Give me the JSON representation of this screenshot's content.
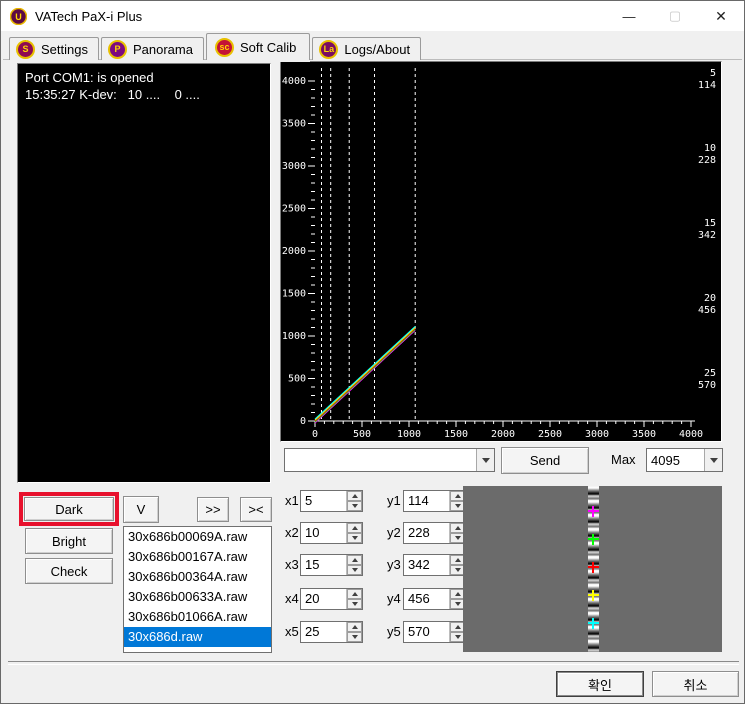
{
  "window": {
    "title": "VATech PaX-i Plus",
    "minimize_glyph": "—",
    "maximize_glyph": "▢",
    "close_glyph": "✕"
  },
  "tabs": [
    {
      "label": "Settings",
      "badge": "S",
      "badge_color": "#8e0b52",
      "active": false
    },
    {
      "label": "Panorama",
      "badge": "P",
      "badge_color": "#7c0a80",
      "active": false
    },
    {
      "label": "Soft Calib",
      "badge": "sc",
      "badge_color": "#c41236",
      "active": true
    },
    {
      "label": "Logs/About",
      "badge": "La",
      "badge_color": "#7a0d62",
      "active": false
    }
  ],
  "log": {
    "lines": [
      "Port COM1: is opened",
      "15:35:27 K-dev:   10 ....    0 ...."
    ]
  },
  "chart_data": {
    "type": "line",
    "title": "",
    "xlabel": "",
    "ylabel": "",
    "xlim": [
      0,
      4000
    ],
    "ylim": [
      0,
      4000
    ],
    "tick_major": 500,
    "tick_minor": 100,
    "grid": "white dashed vertical lines at exposure positions",
    "dashed_vlines_x": [
      69,
      167,
      364,
      633,
      1066
    ],
    "series": [
      {
        "name": "point1",
        "color": "#ff00ff",
        "points": [
          [
            0,
            0
          ],
          [
            1066,
            1090
          ]
        ]
      },
      {
        "name": "point2",
        "color": "#00ff00",
        "points": [
          [
            0,
            0
          ],
          [
            1066,
            1090
          ]
        ]
      },
      {
        "name": "point3",
        "color": "#ff0000",
        "points": [
          [
            0,
            0
          ],
          [
            1066,
            1090
          ]
        ]
      },
      {
        "name": "point4",
        "color": "#ffff00",
        "points": [
          [
            0,
            0
          ],
          [
            1066,
            1090
          ]
        ]
      },
      {
        "name": "point5",
        "color": "#00ffff",
        "points": [
          [
            0,
            0
          ],
          [
            1066,
            1090
          ]
        ]
      }
    ],
    "right_labels": [
      {
        "line1": "5",
        "line2": "114",
        "color": "#ff00ff"
      },
      {
        "line1": "10",
        "line2": "228",
        "color": "#00ff00"
      },
      {
        "line1": "15",
        "line2": "342",
        "color": "#ff0000"
      },
      {
        "line1": "20",
        "line2": "456",
        "color": "#ffff00"
      },
      {
        "line1": "25",
        "line2": "570",
        "color": "#00ffff"
      }
    ],
    "legend_position": "right-inside"
  },
  "send_row": {
    "combo_value": "",
    "send_label": "Send",
    "max_label": "Max",
    "max_value": "4095"
  },
  "left_controls": {
    "dark_label": "Dark",
    "bright_label": "Bright",
    "check_label": "Check",
    "v_label": "V",
    "forward_label": ">>",
    "swap_label": "><"
  },
  "files": {
    "items": [
      "30x686b00069A.raw",
      "30x686b00167A.raw",
      "30x686b00364A.raw",
      "30x686b00633A.raw",
      "30x686b01066A.raw",
      "30x686d.raw"
    ],
    "selected_index": 5
  },
  "calibration": {
    "rows": [
      {
        "x_label": "x1",
        "x_value": "5",
        "y_label": "y1",
        "y_value": "114"
      },
      {
        "x_label": "x2",
        "x_value": "10",
        "y_label": "y2",
        "y_value": "228"
      },
      {
        "x_label": "x3",
        "x_value": "15",
        "y_label": "y3",
        "y_value": "342"
      },
      {
        "x_label": "x4",
        "x_value": "20",
        "y_label": "y4",
        "y_value": "456"
      },
      {
        "x_label": "x5",
        "x_value": "25",
        "y_label": "y5",
        "y_value": "570"
      }
    ]
  },
  "image_panel": {
    "markers": [
      {
        "name": "marker-1",
        "color": "#ff00ff"
      },
      {
        "name": "marker-2",
        "color": "#00ff00"
      },
      {
        "name": "marker-3",
        "color": "#ff0000"
      },
      {
        "name": "marker-4",
        "color": "#ffff00"
      },
      {
        "name": "marker-5",
        "color": "#00ffff"
      }
    ]
  },
  "footer": {
    "ok_label": "확인",
    "cancel_label": "취소"
  }
}
